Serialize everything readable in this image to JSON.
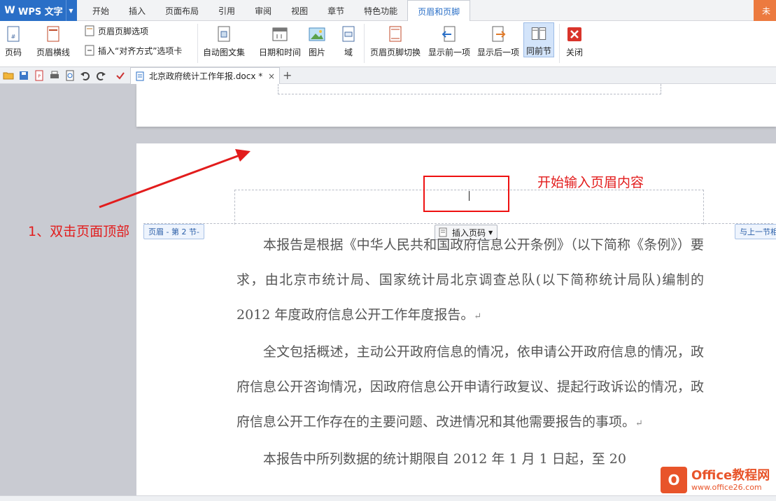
{
  "app": {
    "name": "WPS 文字",
    "right_tab": "未"
  },
  "menu_tabs": [
    "开始",
    "插入",
    "页面布局",
    "引用",
    "审阅",
    "视图",
    "章节",
    "特色功能",
    "页眉和页脚"
  ],
  "ribbon": {
    "page_number": "页码",
    "header_line": "页眉横线",
    "header_footer_options": "页眉页脚选项",
    "insert_align_tab": "插入“对齐方式”选项卡",
    "auto_text": "自动图文集",
    "datetime": "日期和时间",
    "picture": "图片",
    "field": "域",
    "switch_header_footer": "页眉页脚切换",
    "show_previous": "显示前一项",
    "show_next": "显示后一项",
    "same_as_previous": "同前节",
    "close": "关闭"
  },
  "document_tab": {
    "title": "北京政府统计工作年报.docx *",
    "close": "×",
    "add": "+"
  },
  "header_tools": {
    "header_label": "页眉 - 第 2 节-",
    "same_as_previous_label": "与上一节相",
    "insert_page_number": "插入页码"
  },
  "annotations": {
    "step1": "1、双击页面顶部",
    "start_typing": "开始输入页眉内容"
  },
  "body": {
    "p1": "本报告是根据《中华人民共和国政府信息公开条例》（以下简称《条例》）要求，由北京市统计局、国家统计局北京调查总队(以下简称统计局队)编制的 2012 年度政府信息公开工作年度报告。",
    "p2": "全文包括概述，主动公开政府信息的情况，依申请公开政府信息的情况，政府信息公开咨询情况，因政府信息公开申请行政复议、提起行政诉讼的情况，政府信息公开工作存在的主要问题、改进情况和其他需要报告的事项。",
    "p3": "本报告中所列数据的统计期限自 2012 年 1 月 1 日起，至 20",
    "para_mark": "↵"
  },
  "watermark": {
    "line1": "Office教程网",
    "line2": "www.office26.com"
  }
}
